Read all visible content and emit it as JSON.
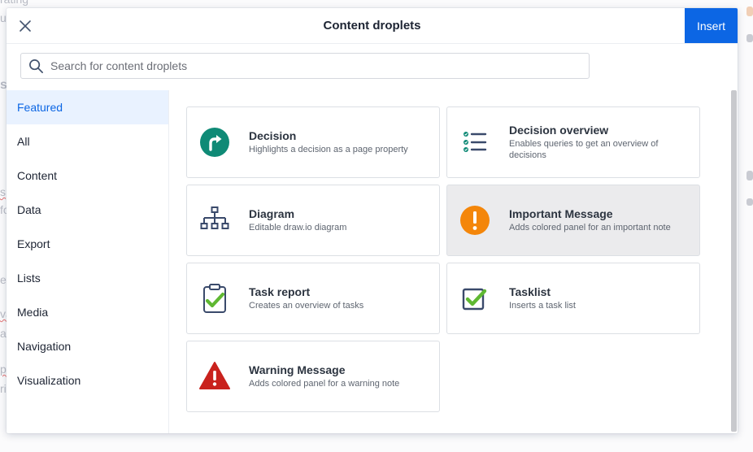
{
  "background": {
    "fragments": [
      "rating",
      "u",
      "s",
      "s",
      "fo",
      "e",
      "va",
      "a",
      "p",
      "ri"
    ]
  },
  "dialog": {
    "title": "Content droplets",
    "insert_label": "Insert",
    "close_icon": "close-icon",
    "search": {
      "placeholder": "Search for content droplets",
      "value": ""
    }
  },
  "categories": [
    {
      "label": "Featured",
      "active": true
    },
    {
      "label": "All"
    },
    {
      "label": "Content"
    },
    {
      "label": "Data"
    },
    {
      "label": "Export"
    },
    {
      "label": "Lists"
    },
    {
      "label": "Media"
    },
    {
      "label": "Navigation"
    },
    {
      "label": "Visualization"
    }
  ],
  "droplets": [
    {
      "name": "Decision",
      "description": "Highlights a decision as a page property",
      "icon": "decision-icon"
    },
    {
      "name": "Decision overview",
      "description": "Enables queries to get an overview of decisions",
      "icon": "decision-overview-icon"
    },
    {
      "name": "Diagram",
      "description": "Editable draw.io diagram",
      "icon": "diagram-icon"
    },
    {
      "name": "Important Message",
      "description": "Adds colored panel for an important note",
      "icon": "important-message-icon"
    },
    {
      "name": "Task report",
      "description": "Creates an overview of tasks",
      "icon": "task-report-icon"
    },
    {
      "name": "Tasklist",
      "description": "Inserts a task list",
      "icon": "tasklist-icon"
    },
    {
      "name": "Warning Message",
      "description": "Adds colored panel for a warning note",
      "icon": "warning-message-icon"
    }
  ],
  "colors": {
    "accent": "#0c66e4",
    "decision": "#0f8a76",
    "important": "#f4860a",
    "warning": "#c9221d",
    "check": "#5fb832",
    "navy": "#3a4a6b"
  }
}
